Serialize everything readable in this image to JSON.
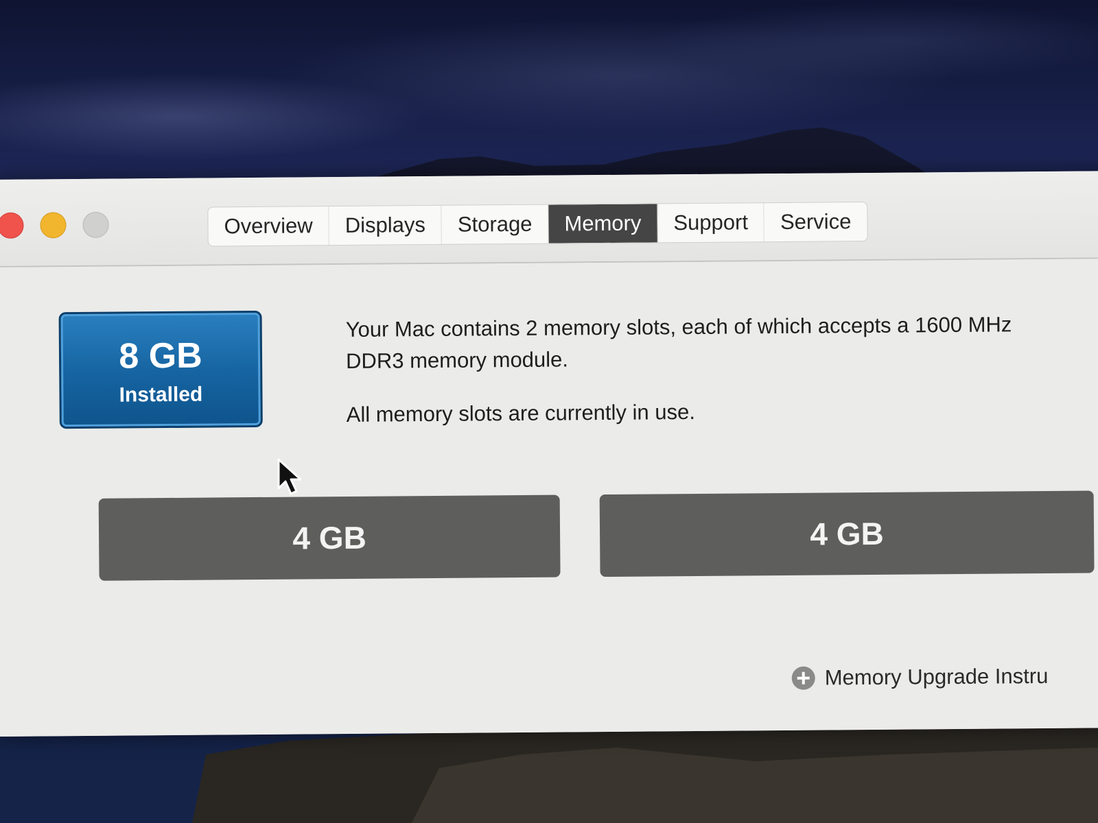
{
  "window": {
    "tabs": [
      {
        "label": "Overview",
        "active": false
      },
      {
        "label": "Displays",
        "active": false
      },
      {
        "label": "Storage",
        "active": false
      },
      {
        "label": "Memory",
        "active": true
      },
      {
        "label": "Support",
        "active": false
      },
      {
        "label": "Service",
        "active": false
      }
    ]
  },
  "memory": {
    "installed_size": "8 GB",
    "installed_label": "Installed",
    "description_line1": "Your Mac contains 2 memory slots, each of which accepts a 1600 MHz DDR3 memory module.",
    "description_line2": "All memory slots are currently in use.",
    "slots": [
      {
        "label": "4 GB"
      },
      {
        "label": "4 GB"
      }
    ],
    "upgrade_link": "Memory Upgrade Instru"
  },
  "icons": {
    "close": "close-icon",
    "minimize": "minimize-icon",
    "zoom": "zoom-icon",
    "upgrade": "plus-circle-icon",
    "cursor": "arrow-cursor-icon"
  },
  "colors": {
    "close": "#f0524c",
    "minimize": "#f2b52e",
    "zoom": "#d0d0ce",
    "active_tab": "#454545",
    "installed_badge": "#1563a0",
    "slot": "#5e5e5c"
  }
}
